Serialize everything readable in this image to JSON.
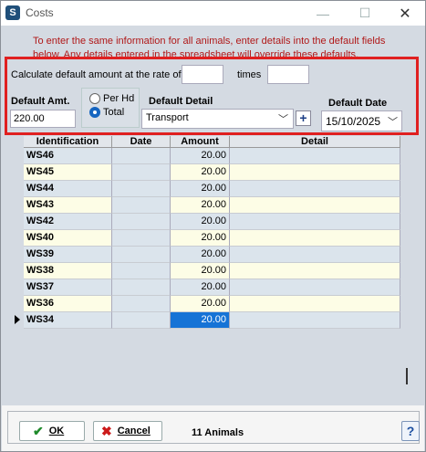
{
  "window": {
    "title": "Costs",
    "minimize_glyph": "—",
    "maximize_glyph": "☐",
    "close_glyph": "✕",
    "app_icon_letter": "S"
  },
  "notice": "To enter the same information for all animals, enter details into the default fields below. Any details entered in the spreadsheet will override these defaults.",
  "calc": {
    "label": "Calculate default amount at the rate of",
    "rate_value": "",
    "times_label": "times",
    "times_value": ""
  },
  "default_amt": {
    "label": "Default Amt.",
    "value": "220.00"
  },
  "mode": {
    "options": [
      "Per Hd",
      "Total"
    ],
    "selected": "Total"
  },
  "default_detail": {
    "label": "Default Detail",
    "value": "Transport"
  },
  "default_date": {
    "label": "Default Date",
    "value": "15/10/2025"
  },
  "grid": {
    "columns": [
      "Identification",
      "Date",
      "Amount",
      "Detail"
    ],
    "rows": [
      {
        "id": "WS46",
        "date": "",
        "amount": "20.00",
        "detail": ""
      },
      {
        "id": "WS45",
        "date": "",
        "amount": "20.00",
        "detail": ""
      },
      {
        "id": "WS44",
        "date": "",
        "amount": "20.00",
        "detail": ""
      },
      {
        "id": "WS43",
        "date": "",
        "amount": "20.00",
        "detail": ""
      },
      {
        "id": "WS42",
        "date": "",
        "amount": "20.00",
        "detail": ""
      },
      {
        "id": "WS40",
        "date": "",
        "amount": "20.00",
        "detail": ""
      },
      {
        "id": "WS39",
        "date": "",
        "amount": "20.00",
        "detail": ""
      },
      {
        "id": "WS38",
        "date": "",
        "amount": "20.00",
        "detail": ""
      },
      {
        "id": "WS37",
        "date": "",
        "amount": "20.00",
        "detail": ""
      },
      {
        "id": "WS36",
        "date": "",
        "amount": "20.00",
        "detail": ""
      },
      {
        "id": "WS34",
        "date": "",
        "amount": "20.00",
        "detail": ""
      }
    ],
    "current_row": "WS34"
  },
  "footer": {
    "ok_label": "OK",
    "cancel_label": "Cancel",
    "count_text": "11 Animals",
    "help_glyph": "?"
  },
  "colors": {
    "notice_text": "#b01818",
    "highlight_border": "#e02020",
    "selected_cell": "#1673d6",
    "row_alt_a": "#dbe4ec",
    "row_alt_b": "#fdfde6"
  }
}
